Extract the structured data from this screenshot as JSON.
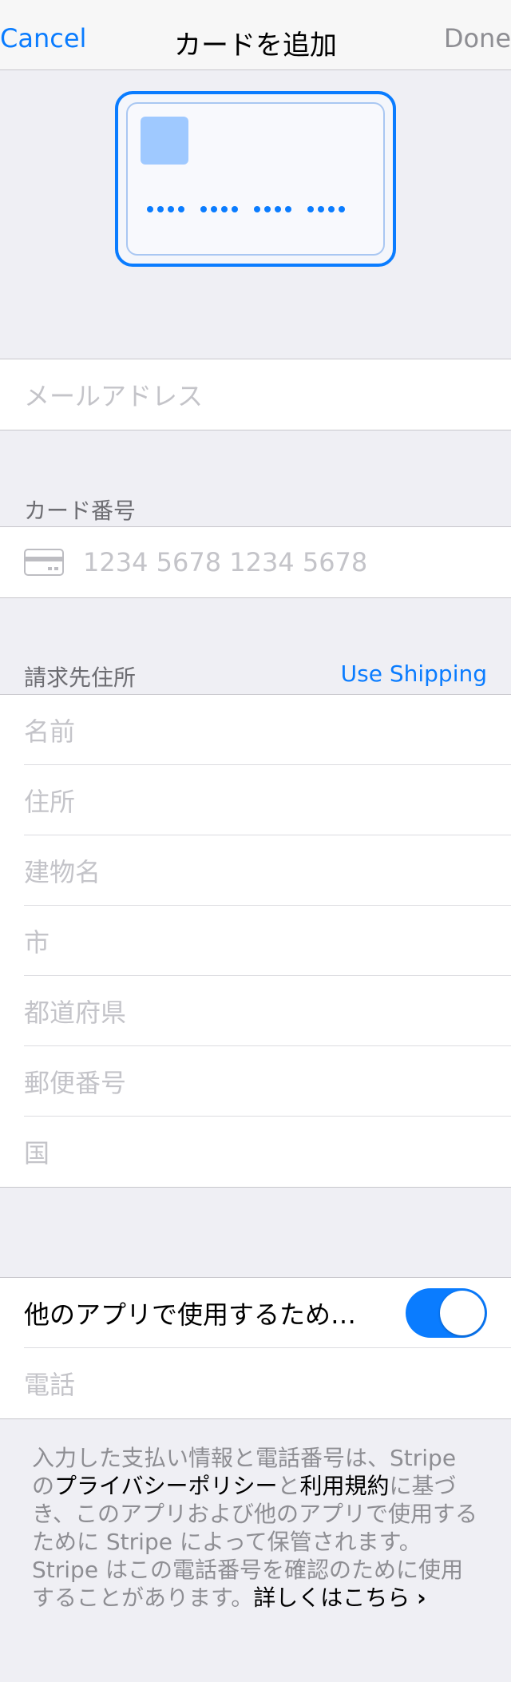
{
  "navbar": {
    "cancel_label": "Cancel",
    "title": "カードを追加",
    "done_label": "Done"
  },
  "email": {
    "placeholder": "メールアドレス"
  },
  "card_section": {
    "header": "カード番号",
    "number_placeholder": "1234 5678 1234 5678"
  },
  "billing": {
    "header": "請求先住所",
    "use_shipping_label": "Use Shipping",
    "fields": [
      {
        "placeholder": "名前"
      },
      {
        "placeholder": "住所"
      },
      {
        "placeholder": "建物名"
      },
      {
        "placeholder": "市"
      },
      {
        "placeholder": "都道府県"
      },
      {
        "placeholder": "郵便番号"
      },
      {
        "placeholder": "国"
      }
    ]
  },
  "save": {
    "toggle_label": "他のアプリで使用するため…",
    "toggle_on": true,
    "phone_placeholder": "電話"
  },
  "footer": {
    "text1": "入力した支払い情報と電話番号は、Stripe の",
    "privacy_link": "プライバシーポリシー",
    "text2": "と",
    "terms_link": "利用規約",
    "text3": "に基づき、このアプリおよび他のアプリで使用するために Stripe によって保管されます。Stripe はこの電話番号を確認のために使用することがあります。",
    "learn_more_link": "詳しくはこちら",
    "chevron": "›"
  },
  "colors": {
    "accent": "#0a7cff",
    "background": "#efeff4",
    "placeholder": "#c4c4c9"
  }
}
